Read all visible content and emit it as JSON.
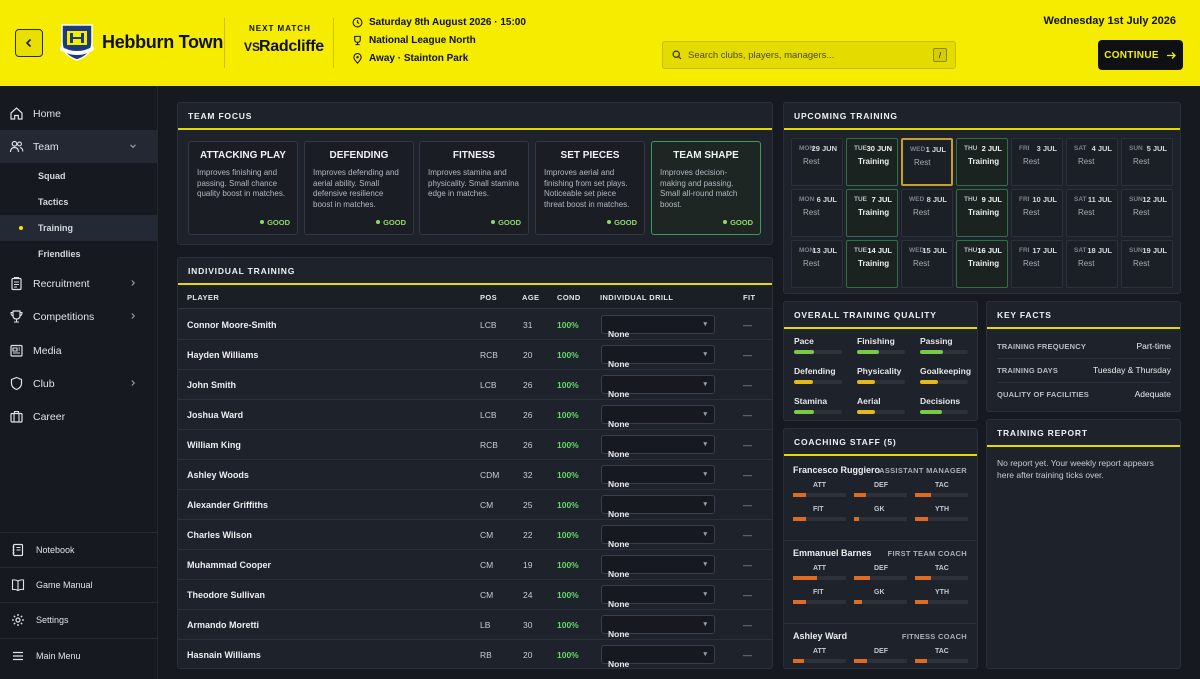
{
  "header": {
    "club_name": "Hebburn Town",
    "next_match_label": "NEXT MATCH",
    "vs_label": "VS",
    "opponent": "Radcliffe",
    "match_datetime": "Saturday 8th August 2026 · 15:00",
    "competition": "National League North",
    "venue": "Away · Stainton Park",
    "search_placeholder": "Search clubs, players, managers...",
    "search_shortcut": "/",
    "current_date": "Wednesday 1st July 2026",
    "continue_label": "CONTINUE",
    "colors": {
      "accent": "#f5ec00",
      "background": "#161920",
      "panel": "#1e222a"
    }
  },
  "sidebar": {
    "items": [
      {
        "label": "Home",
        "icon": "home-icon"
      },
      {
        "label": "Team",
        "icon": "users-icon",
        "expanded": true
      },
      {
        "label": "Recruitment",
        "icon": "clipboard-icon"
      },
      {
        "label": "Competitions",
        "icon": "trophy-icon"
      },
      {
        "label": "Media",
        "icon": "newspaper-icon"
      },
      {
        "label": "Club",
        "icon": "shield-icon"
      },
      {
        "label": "Career",
        "icon": "career-icon"
      }
    ],
    "team_sub": [
      "Squad",
      "Tactics",
      "Training",
      "Friendlies"
    ],
    "active_sub": "Training",
    "bottom": [
      {
        "label": "Notebook",
        "icon": "notebook-icon"
      },
      {
        "label": "Game Manual",
        "icon": "book-icon"
      },
      {
        "label": "Settings",
        "icon": "gear-icon"
      },
      {
        "label": "Main Menu",
        "icon": "menu-icon"
      }
    ]
  },
  "team_focus": {
    "title": "TEAM FOCUS",
    "selected": "TEAM SHAPE",
    "options": [
      {
        "title": "ATTACKING PLAY",
        "desc": "Improves finishing and passing. Small chance quality boost in matches.",
        "grade": "GOOD"
      },
      {
        "title": "DEFENDING",
        "desc": "Improves defending and aerial ability. Small defensive resilience boost in matches.",
        "grade": "GOOD"
      },
      {
        "title": "FITNESS",
        "desc": "Improves stamina and physicality. Small stamina edge in matches.",
        "grade": "GOOD"
      },
      {
        "title": "SET PIECES",
        "desc": "Improves aerial and finishing from set plays. Noticeable set piece threat boost in matches.",
        "grade": "GOOD"
      },
      {
        "title": "TEAM SHAPE",
        "desc": "Improves decision-making and passing. Small all-round match boost.",
        "grade": "GOOD"
      }
    ]
  },
  "individual_training": {
    "title": "INDIVIDUAL TRAINING",
    "columns": {
      "player": "PLAYER",
      "pos": "POS",
      "age": "AGE",
      "cond": "COND",
      "drill": "INDIVIDUAL DRILL",
      "fit": "FIT"
    },
    "rows": [
      {
        "name": "Connor Moore-Smith",
        "pos": "LCB",
        "age": "31",
        "cond": "100%",
        "drill": "None",
        "fit": "—"
      },
      {
        "name": "Hayden Williams",
        "pos": "RCB",
        "age": "20",
        "cond": "100%",
        "drill": "None",
        "fit": "—"
      },
      {
        "name": "John Smith",
        "pos": "LCB",
        "age": "26",
        "cond": "100%",
        "drill": "None",
        "fit": "—"
      },
      {
        "name": "Joshua Ward",
        "pos": "LCB",
        "age": "26",
        "cond": "100%",
        "drill": "None",
        "fit": "—"
      },
      {
        "name": "William King",
        "pos": "RCB",
        "age": "26",
        "cond": "100%",
        "drill": "None",
        "fit": "—"
      },
      {
        "name": "Ashley Woods",
        "pos": "CDM",
        "age": "32",
        "cond": "100%",
        "drill": "None",
        "fit": "—"
      },
      {
        "name": "Alexander Griffiths",
        "pos": "CM",
        "age": "25",
        "cond": "100%",
        "drill": "None",
        "fit": "—"
      },
      {
        "name": "Charles Wilson",
        "pos": "CM",
        "age": "22",
        "cond": "100%",
        "drill": "None",
        "fit": "—"
      },
      {
        "name": "Muhammad Cooper",
        "pos": "CM",
        "age": "19",
        "cond": "100%",
        "drill": "None",
        "fit": "—"
      },
      {
        "name": "Theodore Sullivan",
        "pos": "CM",
        "age": "24",
        "cond": "100%",
        "drill": "None",
        "fit": "—"
      },
      {
        "name": "Armando Moretti",
        "pos": "LB",
        "age": "30",
        "cond": "100%",
        "drill": "None",
        "fit": "—"
      },
      {
        "name": "Hasnain Williams",
        "pos": "RB",
        "age": "20",
        "cond": "100%",
        "drill": "None",
        "fit": "—"
      }
    ]
  },
  "upcoming_training": {
    "title": "UPCOMING TRAINING",
    "days": [
      {
        "day": "MON",
        "date": "29 JUN",
        "type": "Rest"
      },
      {
        "day": "TUE",
        "date": "30 JUN",
        "type": "Training"
      },
      {
        "day": "WED",
        "date": "1 JUL",
        "type": "Rest",
        "today": true
      },
      {
        "day": "THU",
        "date": "2 JUL",
        "type": "Training"
      },
      {
        "day": "FRI",
        "date": "3 JUL",
        "type": "Rest"
      },
      {
        "day": "SAT",
        "date": "4 JUL",
        "type": "Rest"
      },
      {
        "day": "SUN",
        "date": "5 JUL",
        "type": "Rest"
      },
      {
        "day": "MON",
        "date": "6 JUL",
        "type": "Rest"
      },
      {
        "day": "TUE",
        "date": "7 JUL",
        "type": "Training"
      },
      {
        "day": "WED",
        "date": "8 JUL",
        "type": "Rest"
      },
      {
        "day": "THU",
        "date": "9 JUL",
        "type": "Training"
      },
      {
        "day": "FRI",
        "date": "10 JUL",
        "type": "Rest"
      },
      {
        "day": "SAT",
        "date": "11 JUL",
        "type": "Rest"
      },
      {
        "day": "SUN",
        "date": "12 JUL",
        "type": "Rest"
      },
      {
        "day": "MON",
        "date": "13 JUL",
        "type": "Rest"
      },
      {
        "day": "TUE",
        "date": "14 JUL",
        "type": "Training"
      },
      {
        "day": "WED",
        "date": "15 JUL",
        "type": "Rest"
      },
      {
        "day": "THU",
        "date": "16 JUL",
        "type": "Training"
      },
      {
        "day": "FRI",
        "date": "17 JUL",
        "type": "Rest"
      },
      {
        "day": "SAT",
        "date": "18 JUL",
        "type": "Rest"
      },
      {
        "day": "SUN",
        "date": "19 JUL",
        "type": "Rest"
      }
    ]
  },
  "training_quality": {
    "title": "OVERALL TRAINING QUALITY",
    "attributes": [
      {
        "name": "Pace",
        "level": 0.42,
        "color": "#7cc94a"
      },
      {
        "name": "Finishing",
        "level": 0.45,
        "color": "#7cc94a"
      },
      {
        "name": "Passing",
        "level": 0.48,
        "color": "#7cc94a"
      },
      {
        "name": "Defending",
        "level": 0.4,
        "color": "#e5b81e"
      },
      {
        "name": "Physicality",
        "level": 0.38,
        "color": "#e5b81e"
      },
      {
        "name": "Goalkeeping",
        "level": 0.38,
        "color": "#e5b81e"
      },
      {
        "name": "Stamina",
        "level": 0.42,
        "color": "#7cc94a"
      },
      {
        "name": "Aerial",
        "level": 0.38,
        "color": "#e5b81e"
      },
      {
        "name": "Decisions",
        "level": 0.45,
        "color": "#7cc94a"
      }
    ]
  },
  "coaching_staff": {
    "title": "COACHING STAFF (5)",
    "coaches": [
      {
        "name": "Francesco Ruggiero",
        "role": "ASSISTANT MANAGER",
        "stats": [
          {
            "label": "ATT",
            "level": 0.25
          },
          {
            "label": "DEF",
            "level": 0.22
          },
          {
            "label": "TAC",
            "level": 0.3
          },
          {
            "label": "FIT",
            "level": 0.25
          },
          {
            "label": "GK",
            "level": 0.1
          },
          {
            "label": "YTH",
            "level": 0.25
          }
        ]
      },
      {
        "name": "Emmanuel Barnes",
        "role": "FIRST TEAM COACH",
        "stats": [
          {
            "label": "ATT",
            "level": 0.45
          },
          {
            "label": "DEF",
            "level": 0.3
          },
          {
            "label": "TAC",
            "level": 0.3
          },
          {
            "label": "FIT",
            "level": 0.25
          },
          {
            "label": "GK",
            "level": 0.15
          },
          {
            "label": "YTH",
            "level": 0.25
          }
        ]
      },
      {
        "name": "Ashley Ward",
        "role": "FITNESS COACH",
        "stats": [
          {
            "label": "ATT",
            "level": 0.2
          },
          {
            "label": "DEF",
            "level": 0.25
          },
          {
            "label": "TAC",
            "level": 0.22
          }
        ]
      }
    ]
  },
  "key_facts": {
    "title": "KEY FACTS",
    "facts": [
      {
        "key": "TRAINING FREQUENCY",
        "value": "Part-time"
      },
      {
        "key": "TRAINING DAYS",
        "value": "Tuesday & Thursday"
      },
      {
        "key": "QUALITY OF FACILITIES",
        "value": "Adequate"
      }
    ]
  },
  "training_report": {
    "title": "TRAINING REPORT",
    "text": "No report yet. Your weekly report appears here after training ticks over."
  }
}
